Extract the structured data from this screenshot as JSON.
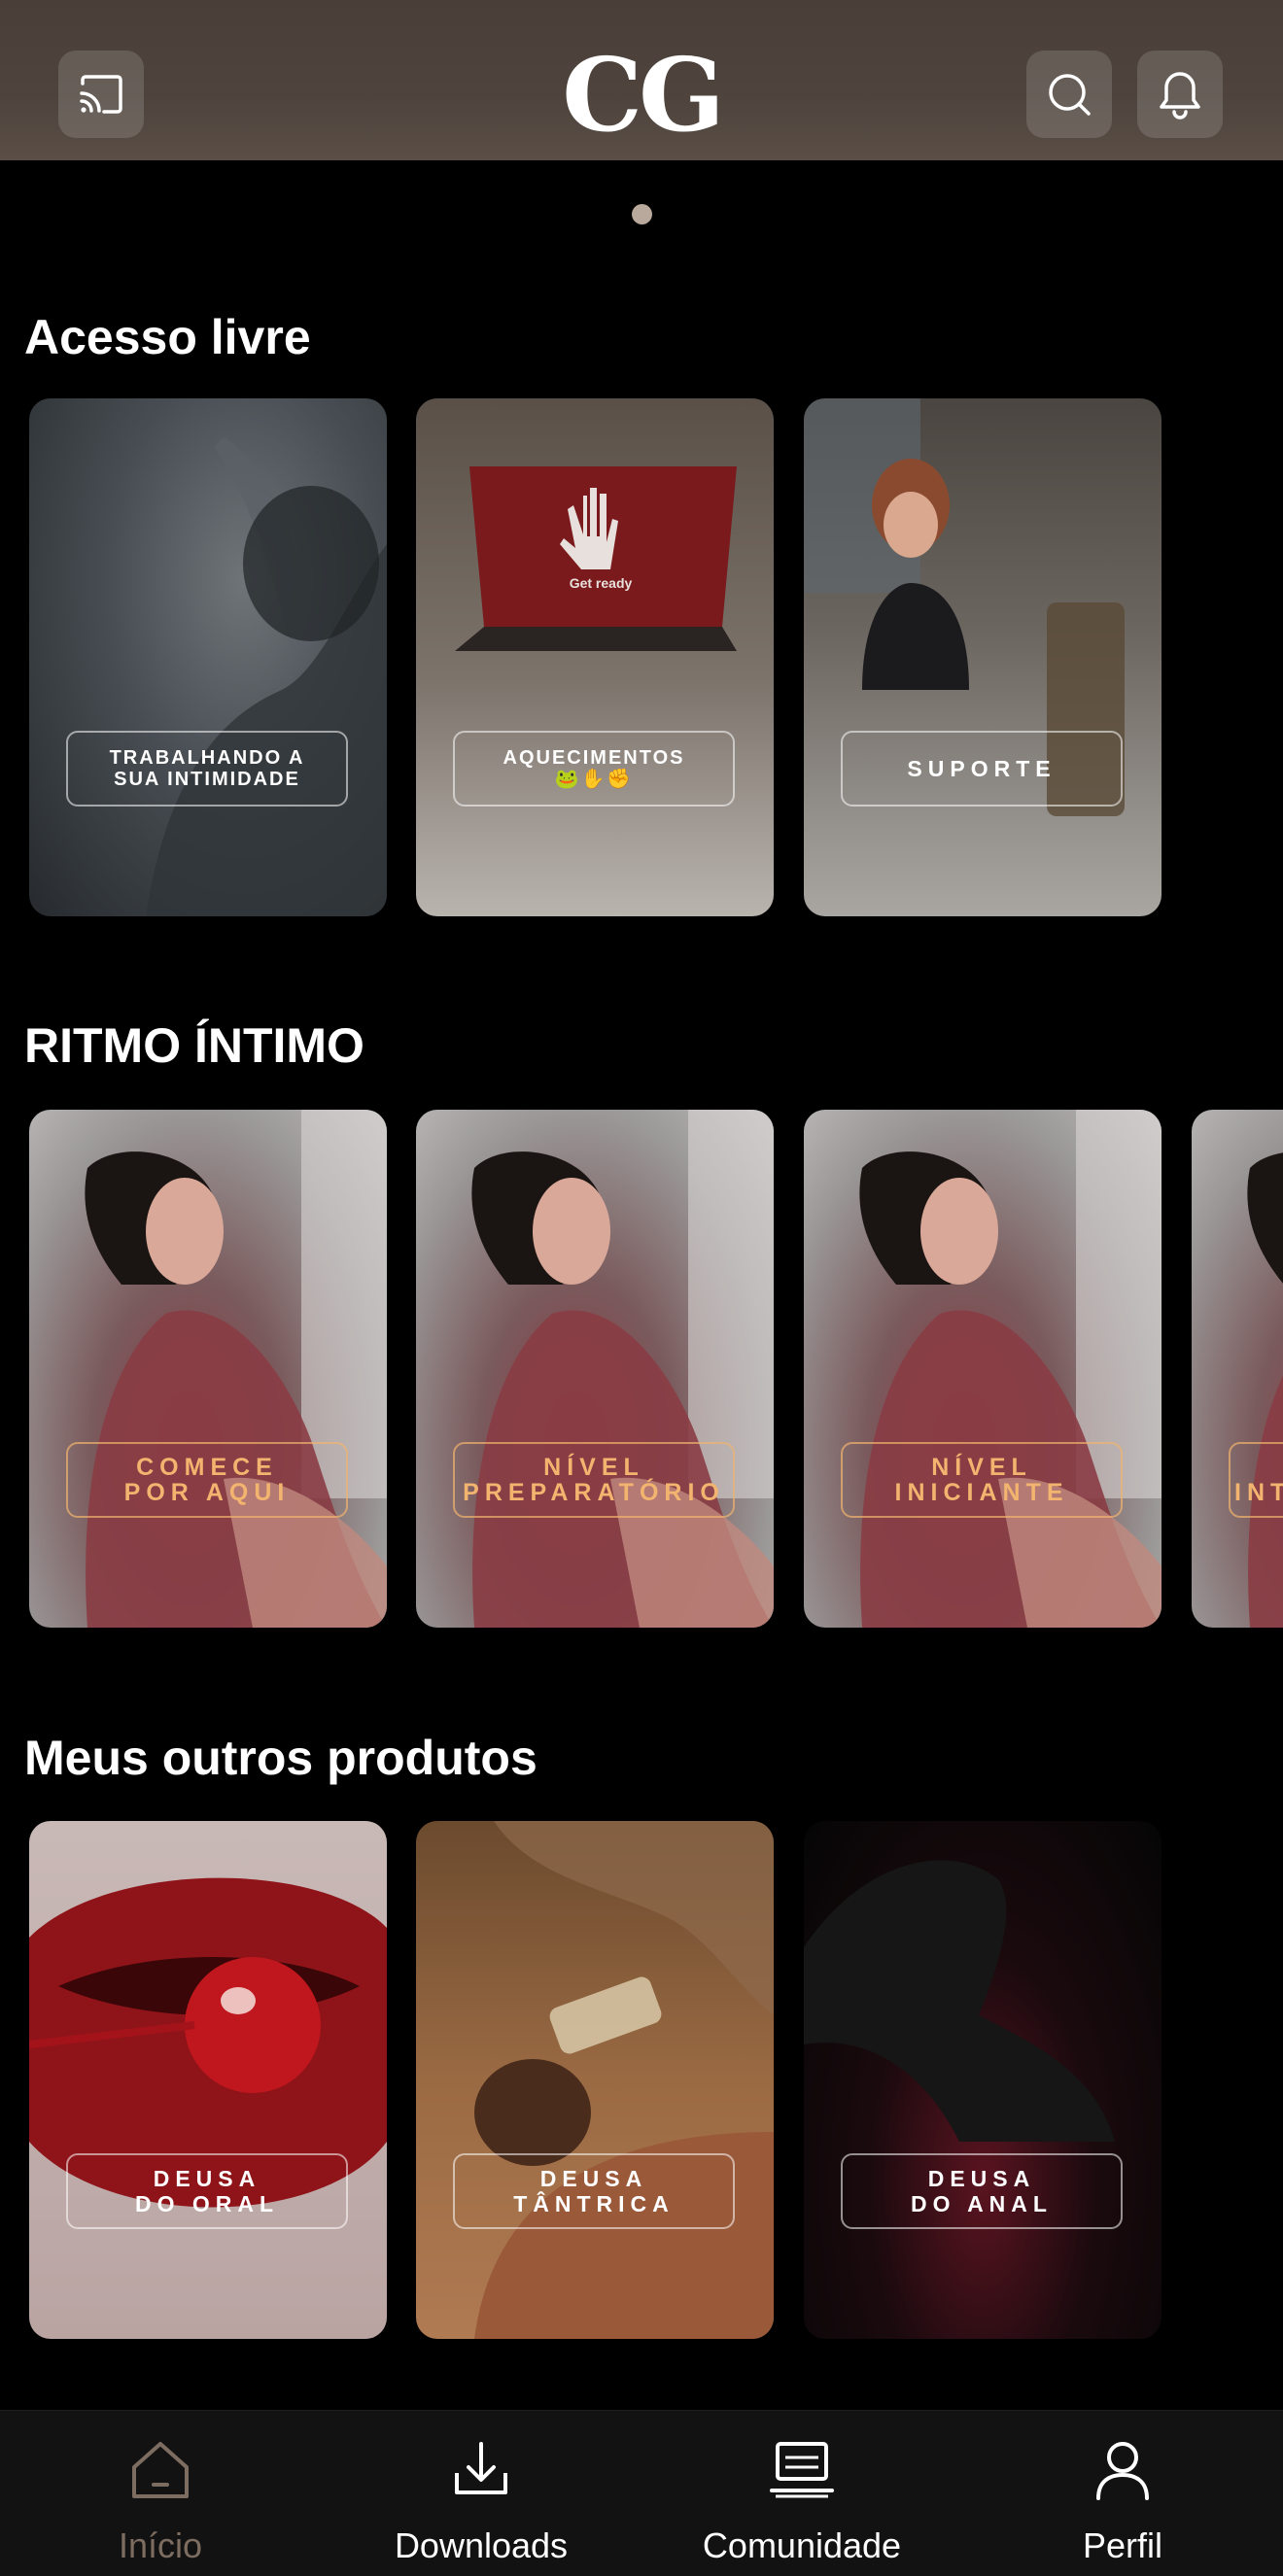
{
  "header": {
    "logo": "CG",
    "cast_icon": "cast-icon",
    "search_icon": "search-icon",
    "bell_icon": "bell-icon"
  },
  "sections": [
    {
      "title": "Acesso livre",
      "cards": [
        {
          "label": "TRABALHANDO A\nSUA INTIMIDADE",
          "image": "woman-arm-raised-photo"
        },
        {
          "label": "AQUECIMENTOS\n🐸✋✊",
          "image": "laptop-get-ready-photo",
          "screen_text": "Get ready"
        },
        {
          "label": "SUPORTE",
          "image": "woman-phone-desk-photo"
        }
      ]
    },
    {
      "title": "RITMO ÍNTIMO",
      "cards": [
        {
          "label": "COMECE\nPOR AQUI",
          "image": "woman-pink-robe-photo"
        },
        {
          "label": "NÍVEL\nPREPARATÓRIO",
          "image": "woman-pink-robe-photo"
        },
        {
          "label": "NÍVEL\nINICIANTE",
          "image": "woman-pink-robe-photo"
        },
        {
          "label": "NÍVEL\nINTERMEDIÁRIO",
          "image": "woman-pink-robe-photo"
        }
      ]
    },
    {
      "title": "Meus outros produtos",
      "cards": [
        {
          "label": "DEUSA\nDO ORAL",
          "image": "lips-cherry-photo"
        },
        {
          "label": "DEUSA\nTÂNTRICA",
          "image": "massage-oil-photo"
        },
        {
          "label": "DEUSA\nDO ANAL",
          "image": "dark-silhouette-photo"
        }
      ]
    }
  ],
  "nav": [
    {
      "label": "Início",
      "icon": "home-icon",
      "active": false
    },
    {
      "label": "Downloads",
      "icon": "download-icon",
      "active": true
    },
    {
      "label": "Comunidade",
      "icon": "laptop-icon",
      "active": true
    },
    {
      "label": "Perfil",
      "icon": "person-icon",
      "active": true
    }
  ],
  "colors": {
    "header_bg": "#4e443d",
    "accent_gold": "#f2b46e",
    "nav_inactive": "#7d6c60",
    "background": "#000000"
  }
}
